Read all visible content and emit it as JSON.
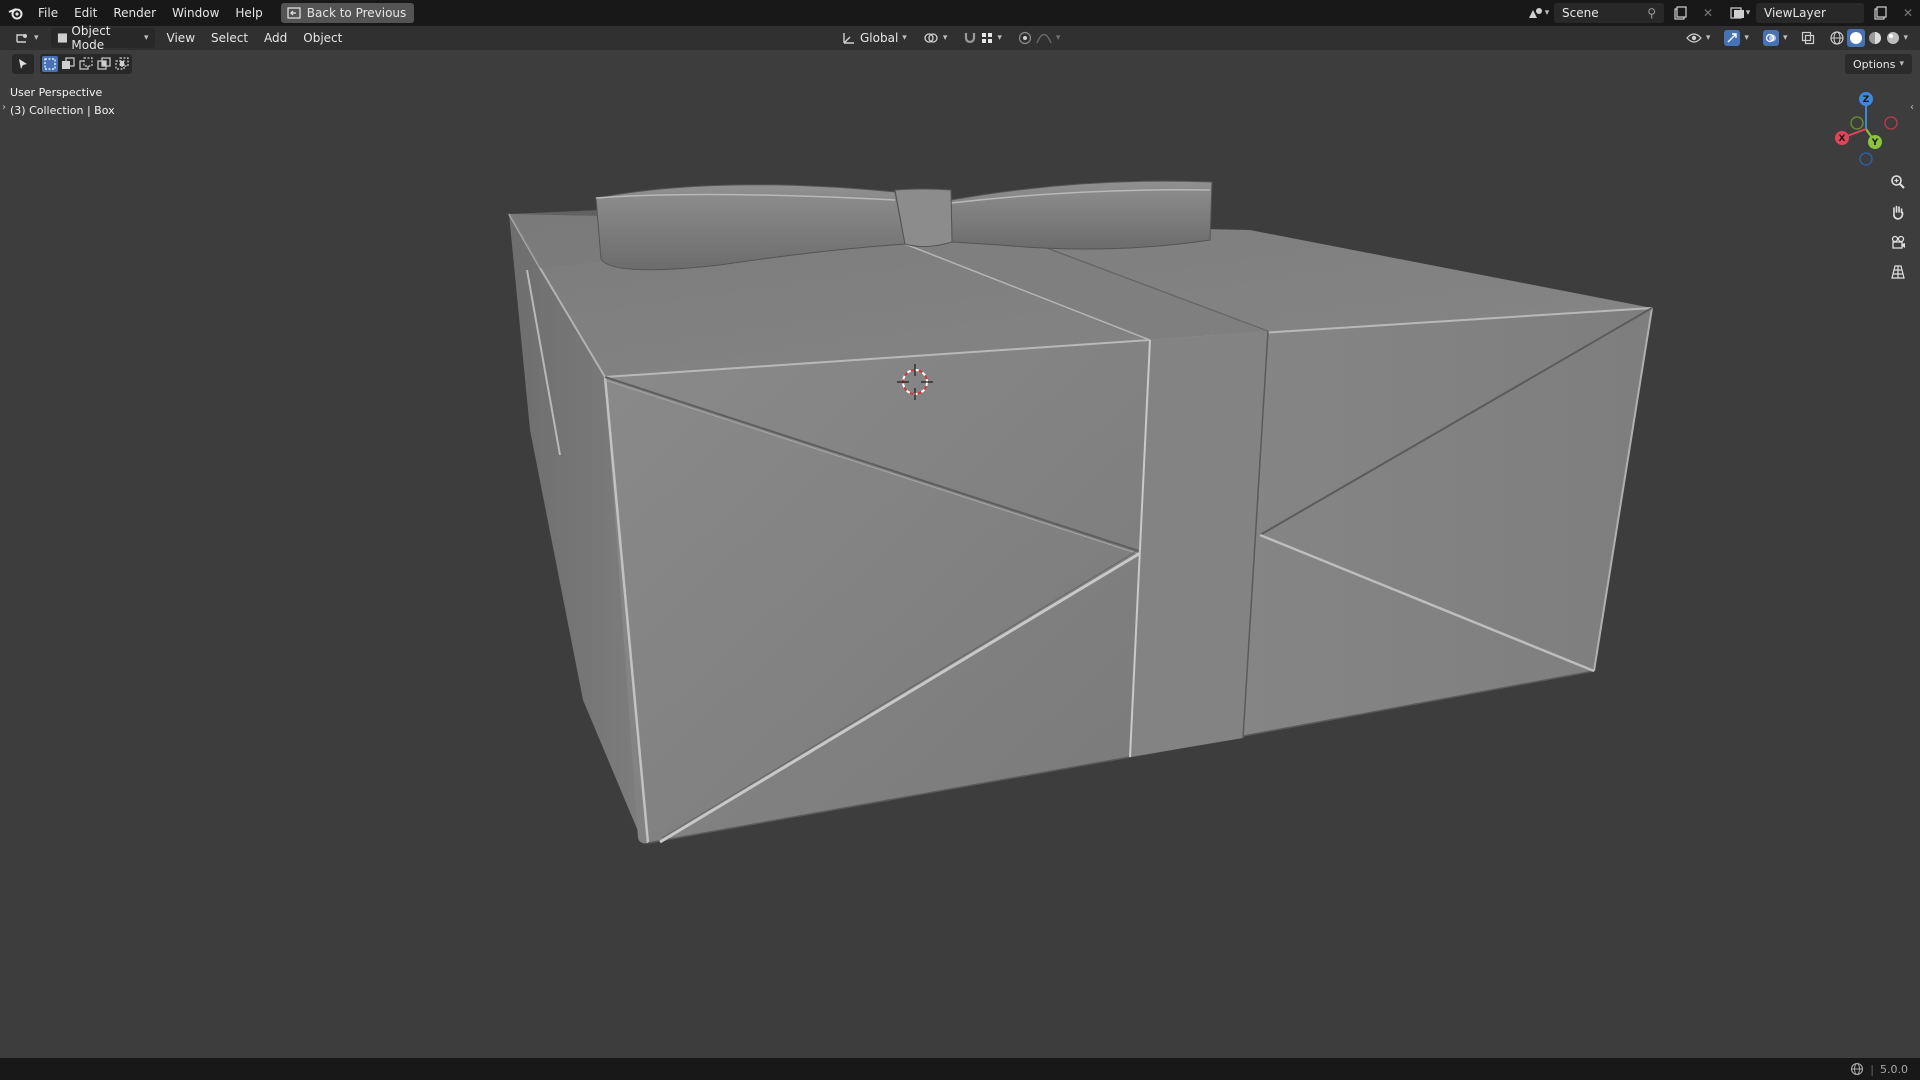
{
  "topbar": {
    "menu": [
      "File",
      "Edit",
      "Render",
      "Window",
      "Help"
    ],
    "back_label": "Back to Previous",
    "scene": "Scene",
    "view_layer": "ViewLayer"
  },
  "header": {
    "editor_icon": "3d-viewport-icon",
    "mode": "Object Mode",
    "menus": [
      "View",
      "Select",
      "Add",
      "Object"
    ],
    "orientation": "Global"
  },
  "viewport": {
    "perspective": "User Perspective",
    "collection": "(3) Collection | Box",
    "options_label": "Options",
    "gizmo": {
      "x": "X",
      "y": "Y",
      "z": "Z"
    }
  },
  "status": {
    "version": "5.0.0"
  },
  "colors": {
    "axis_x": "#e0455b",
    "axis_y": "#8bc43c",
    "axis_z": "#3f86e0",
    "background": "#3d3d3d",
    "header": "#303030",
    "topbar": "#181818",
    "accent": "#4772b3"
  }
}
